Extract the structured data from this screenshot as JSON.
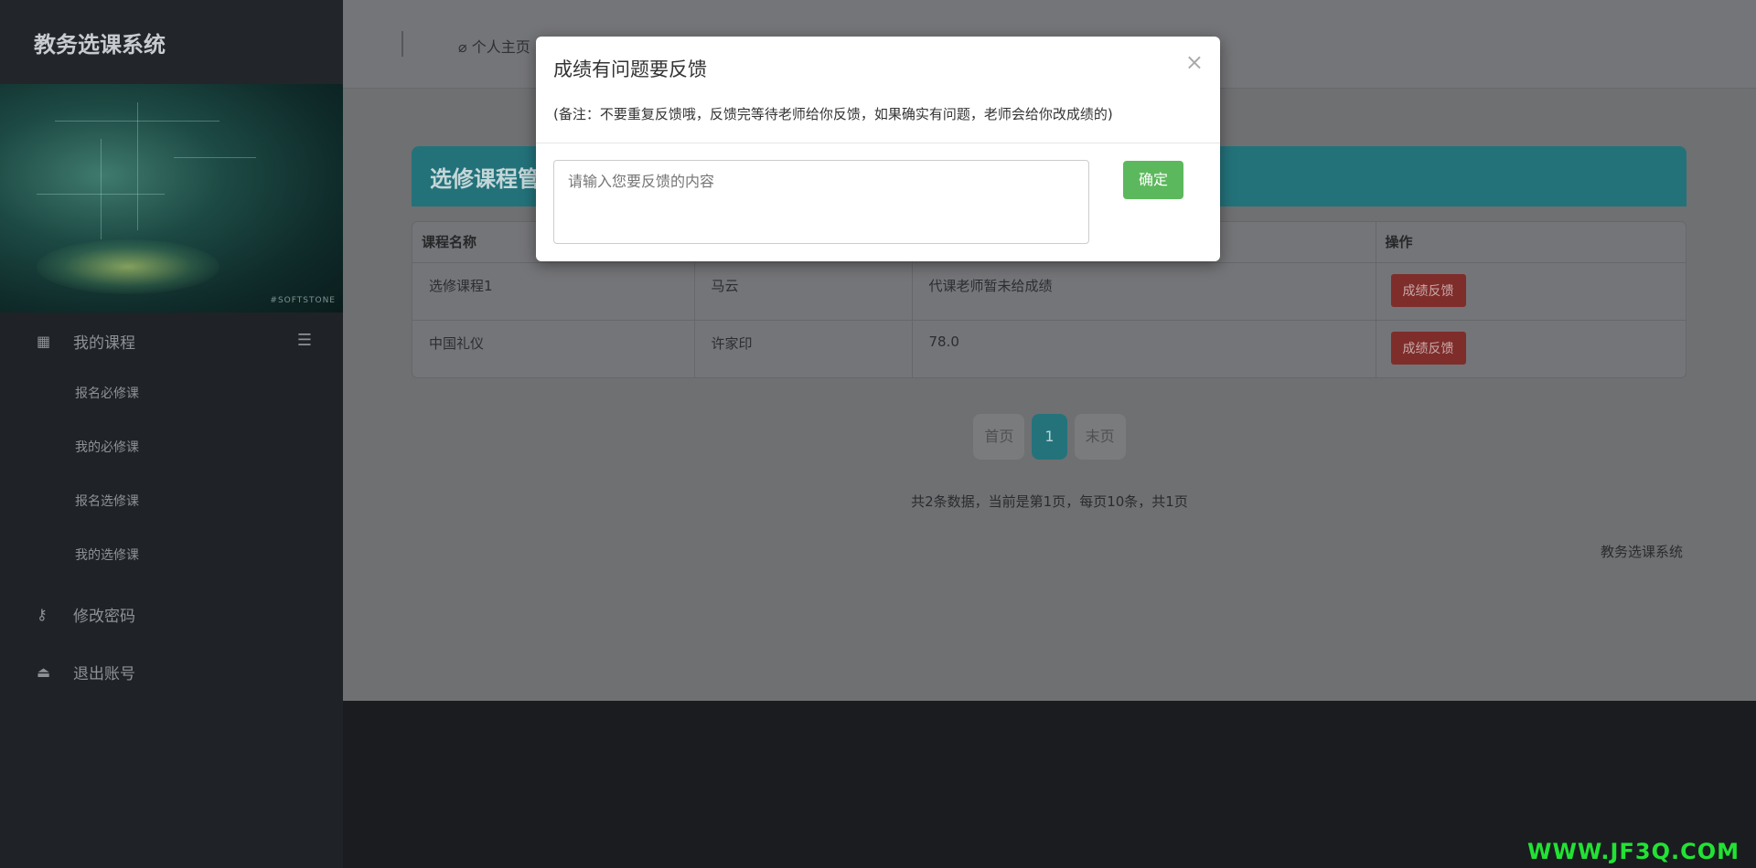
{
  "sidebar": {
    "brand": "教务选课系统",
    "banner_tag": "#SOFTSTONE",
    "menu": {
      "group_label": "我的课程",
      "sub_items": [
        "报名必修课",
        "我的必修课",
        "报名选修课",
        "我的选修课"
      ],
      "change_password": "修改密码",
      "logout": "退出账号"
    }
  },
  "topbar": {
    "home_label": "个人主页"
  },
  "panel": {
    "title": "选修课程管",
    "columns": [
      "课程名称",
      "",
      "",
      "操作"
    ],
    "rows": [
      {
        "course": "选修课程1",
        "teacher": "马云",
        "score": "代课老师暂未给成绩",
        "action": "成绩反馈"
      },
      {
        "course": "中国礼仪",
        "teacher": "许家印",
        "score": "78.0",
        "action": "成绩反馈"
      }
    ]
  },
  "pagination": {
    "first": "首页",
    "current": "1",
    "last": "末页",
    "info": "共2条数据，当前是第1页，每页10条，共1页"
  },
  "footer": {
    "text": "教务选课系统"
  },
  "modal": {
    "title": "成绩有问题要反馈",
    "close": "×",
    "note": "(备注：不要重复反馈哦，反馈完等待老师给你反馈，如果确实有问题，老师会给你改成绩的)",
    "placeholder": "请输入您要反馈的内容",
    "confirm": "确定"
  },
  "watermark": "WWW.JF3Q.COM"
}
